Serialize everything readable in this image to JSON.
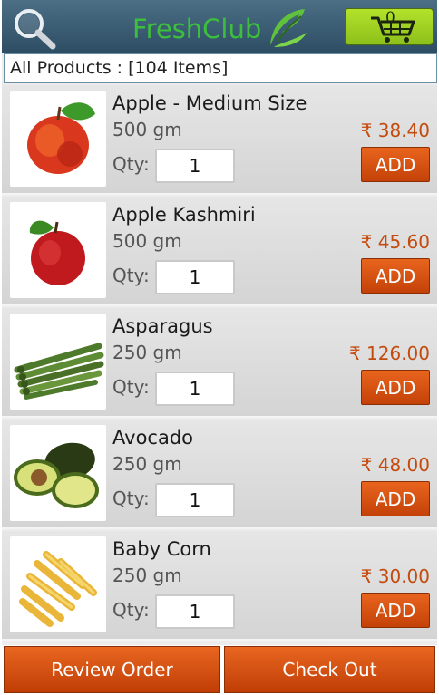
{
  "header": {
    "logo_text": "FreshClub",
    "cart_count": "0",
    "search_icon": "search-icon",
    "cart_icon": "cart-icon",
    "accent_color": "#3cbf3c"
  },
  "category": {
    "label": "All Products : [104 Items]"
  },
  "products": [
    {
      "name": "Apple - Medium Size",
      "weight": "500 gm",
      "price": "₹ 38.40",
      "qty_label": "Qty:",
      "qty": "1",
      "add_label": "ADD",
      "image_icon": "apple-image"
    },
    {
      "name": "Apple Kashmiri",
      "weight": "500 gm",
      "price": "₹ 45.60",
      "qty_label": "Qty:",
      "qty": "1",
      "add_label": "ADD",
      "image_icon": "kashmiri-apple-image"
    },
    {
      "name": "Asparagus",
      "weight": "250 gm",
      "price": "₹ 126.00",
      "qty_label": "Qty:",
      "qty": "1",
      "add_label": "ADD",
      "image_icon": "asparagus-image"
    },
    {
      "name": "Avocado",
      "weight": "250 gm",
      "price": "₹ 48.00",
      "qty_label": "Qty:",
      "qty": "1",
      "add_label": "ADD",
      "image_icon": "avocado-image"
    },
    {
      "name": "Baby Corn",
      "weight": "250 gm",
      "price": "₹ 30.00",
      "qty_label": "Qty:",
      "qty": "1",
      "add_label": "ADD",
      "image_icon": "baby-corn-image"
    }
  ],
  "footer": {
    "review_label": "Review Order",
    "checkout_label": "Check Out"
  },
  "colors": {
    "header": "#3a5d74",
    "button": "#d8561a",
    "price": "#c44a0e"
  }
}
